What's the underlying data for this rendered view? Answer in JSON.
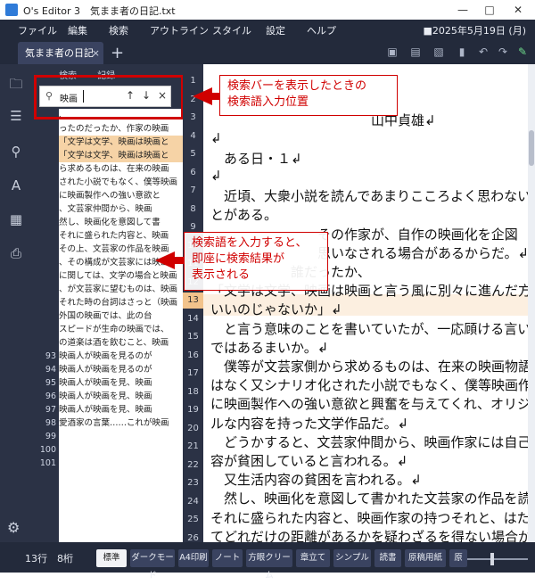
{
  "window": {
    "title": "O's Editor 3　気まま者の日記.txt",
    "controls": [
      "—",
      "□",
      "✕"
    ]
  },
  "menubar": {
    "items": [
      "ファイル",
      "編集",
      "検索",
      "アウトライン",
      "スタイル",
      "設定",
      "ヘルプ"
    ],
    "date": "■2025年5月19日 (月)"
  },
  "tabs": {
    "doc_tab": "気まま者の日記",
    "close": "×",
    "add": "+"
  },
  "toolbar": {
    "icons": [
      "save-icon",
      "save-as-icon",
      "save-all-icon",
      "undo-icon",
      "redo-icon",
      "pen-icon"
    ]
  },
  "sidebar": {
    "icons": [
      "folder-icon",
      "outline-icon",
      "search-icon",
      "font-icon",
      "pdf-icon",
      "print-icon",
      "gear-icon"
    ]
  },
  "search_panel": {
    "header": "検索　— 記録",
    "query": "映画",
    "results": [
      {
        "line": "",
        "text": "、　　　　　",
        "hl": false
      },
      {
        "line": "",
        "text": "ったのだったか、作家の映画",
        "hl": false
      },
      {
        "line": "",
        "text": "「文学は文学、映画は映画と",
        "hl": true
      },
      {
        "line": "",
        "text": "「文学は文学、映画は映画と",
        "hl": true
      },
      {
        "line": "",
        "text": "ら求めるものは、在来の映画",
        "hl": false
      },
      {
        "line": "",
        "text": "された小説でもなく、僕等映画",
        "hl": false
      },
      {
        "line": "",
        "text": "に映画製作への強い意欲と",
        "hl": false
      },
      {
        "line": "",
        "text": "、文芸家仲間から、映画",
        "hl": false
      },
      {
        "line": "",
        "text": "然し、映画化を意図して書",
        "hl": false
      },
      {
        "line": "",
        "text": "それに盛られた内容と、映画",
        "hl": false
      },
      {
        "line": "",
        "text": "その上、文芸家の作品を映画",
        "hl": false
      },
      {
        "line": "",
        "text": "、その構成が文芸家には映画",
        "hl": false
      },
      {
        "line": "",
        "text": "に関しては、文学の場合と映画",
        "hl": false
      },
      {
        "line": "",
        "text": "、が文芸家に望むものは、映画",
        "hl": false
      },
      {
        "line": "",
        "text": "それた時の台詞はさっと（映画",
        "hl": false
      },
      {
        "line": "",
        "text": "外国の映画では、此の台",
        "hl": false
      },
      {
        "line": "",
        "text": "スピードが生命の映画では、",
        "hl": false
      },
      {
        "line": "",
        "text": "の道楽は酒を飲むこと、映画",
        "hl": false
      },
      {
        "line": "",
        "text": "映画人が映画を見るのが",
        "hl": false
      },
      {
        "line": "",
        "text": "映画人が映画を見るのが",
        "hl": false
      },
      {
        "line": "",
        "text": "映画人が映画を見、映画",
        "hl": false
      },
      {
        "line": "",
        "text": "映画人が映画を見、映画",
        "hl": false
      },
      {
        "line": "",
        "text": "映画人が映画を見、映画",
        "hl": false
      },
      {
        "line": "",
        "text": "愛酒家の言葉……これが映画",
        "hl": false
      }
    ],
    "line_numbers": [
      "",
      "",
      "",
      "",
      "",
      "",
      "",
      "",
      "",
      "",
      "",
      "",
      "",
      "",
      "",
      "",
      "",
      "",
      "93",
      "94",
      "95",
      "96",
      "97",
      "98",
      "99",
      "100",
      "101"
    ]
  },
  "gutter": {
    "numbers": [
      "1",
      "2",
      "3",
      "4",
      "5",
      "6",
      "7",
      "8",
      "9",
      "10",
      "11",
      "12",
      "13",
      "14",
      "15",
      "16",
      "17",
      "18",
      "19",
      "20",
      "21",
      "22",
      "23",
      "24",
      "25",
      "26",
      "27"
    ],
    "current": "13"
  },
  "editor": {
    "lines": [
      "　　　　　　　　　　　　　　　　　　",
      "　　　　　　　　　　　　　　　　　　",
      "　　　　　　　　　　　　山中貞雄↲",
      "↲",
      "　ある日・１↲",
      "↲",
      "　近頃、大衆小説を読んであまりこころよく思わないこ",
      "とがある。",
      "　　　　　　　　その作家が、自作の映画化を企図",
      "　　　　　　　　思いなされる場合があるからだ。↲",
      "　　　　　　誰だったか、",
      "「文学は文学、映画は映画と言う風に別々に進んだ方が",
      "いいのじゃないか」↲",
      "　と言う意味のことを書いていたが、一応頋ける言い分",
      "ではあるまいか。↲",
      "　僕等が文芸家側から求めるものは、在来の映画物語で",
      "はなく又シナリオ化された小説でもなく、僕等映画作家",
      "に映画製作への強い意欲と興奮を与えてくれ、オリジナ",
      "ルな内容を持った文学作品だ。↲",
      "　どうかすると、文芸家仲間から、映画作家には自己内",
      "容が貧困していると言われる。↲",
      "　又生活内容の貧困を言われる。↲",
      "　然し、映画化を意図して書かれた文芸家の作品を読んで、",
      "それに盛られた内容と、映画作家の持つそれと、はたし",
      "てどれだけの距離があるかを疑わざるを得ない場合が多"
    ]
  },
  "callouts": {
    "search_bar": "検索バーを表示したときの\n検索語入力位置",
    "results": "検索語を入力すると、\n即座に検索結果が\n表示される"
  },
  "status": {
    "position": "13行　8桁",
    "tabs": [
      "標準",
      "ダークモード",
      "A4印刷",
      "ノート",
      "方眼クリーム",
      "章立て",
      "シンプル",
      "読書",
      "原稿用紙",
      "原"
    ],
    "active_tab": "標準"
  },
  "colors": {
    "menubar": "#232a3b",
    "panel": "#2b3245",
    "highlight": "#f6d3a6",
    "current_line": "#f2c38c",
    "annotation": "#d00000"
  }
}
